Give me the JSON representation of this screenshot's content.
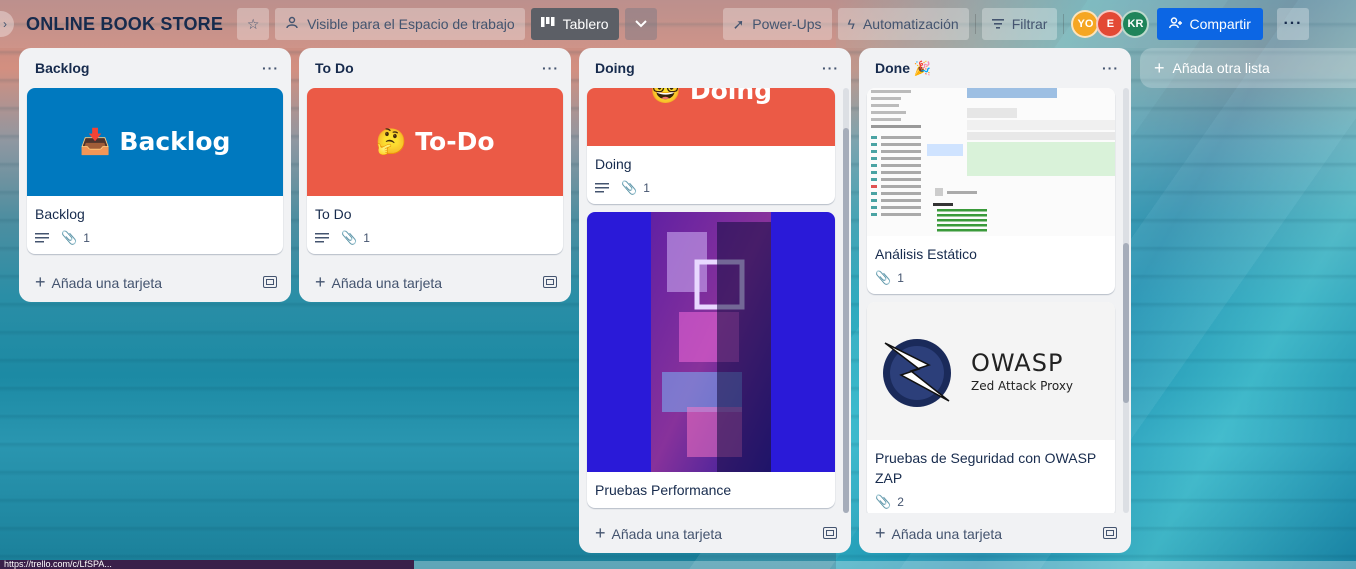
{
  "header": {
    "board_title": "ONLINE BOOK STORE",
    "visibility": "Visible para el Espacio de trabajo",
    "view": "Tablero",
    "powerups": "Power-Ups",
    "automation": "Automatización",
    "filter": "Filtrar",
    "share": "Compartir",
    "members": [
      {
        "initials": "YO",
        "color": "#f5a623"
      },
      {
        "initials": "E",
        "color": "#e34935"
      },
      {
        "initials": "KR",
        "color": "#1f845a"
      }
    ]
  },
  "lists": [
    {
      "title": "Backlog",
      "cards": [
        {
          "cover_text": "📥 Backlog",
          "cover_color": "#0079bf",
          "title": "Backlog",
          "has_description": true,
          "attachments": "1"
        }
      ],
      "add_card": "Añada una tarjeta"
    },
    {
      "title": "To Do",
      "cards": [
        {
          "cover_text": "🤔 To-Do",
          "cover_color": "#eb5a46",
          "title": "To Do",
          "has_description": true,
          "attachments": "1"
        }
      ],
      "add_card": "Añada una tarjeta"
    },
    {
      "title": "Doing",
      "cards": [
        {
          "cover_text": "🤓 Doing",
          "cover_color": "#eb5a46",
          "title": "Doing",
          "has_description": true,
          "attachments": "1"
        },
        {
          "cover_color": "#2a1ad8",
          "title": "Pruebas Performance"
        }
      ],
      "add_card": "Añada una tarjeta"
    },
    {
      "title": "Done 🎉",
      "cards": [
        {
          "title": "Análisis Estático",
          "attachments": "1"
        },
        {
          "cover_title": "OWASP",
          "cover_subtitle": "Zed Attack Proxy",
          "title": "Pruebas de Seguridad con OWASP ZAP",
          "attachments": "2"
        }
      ],
      "add_card": "Añada una tarjeta"
    }
  ],
  "add_list": "Añada otra lista",
  "status_url": "https://trello.com/c/LfSPA..."
}
